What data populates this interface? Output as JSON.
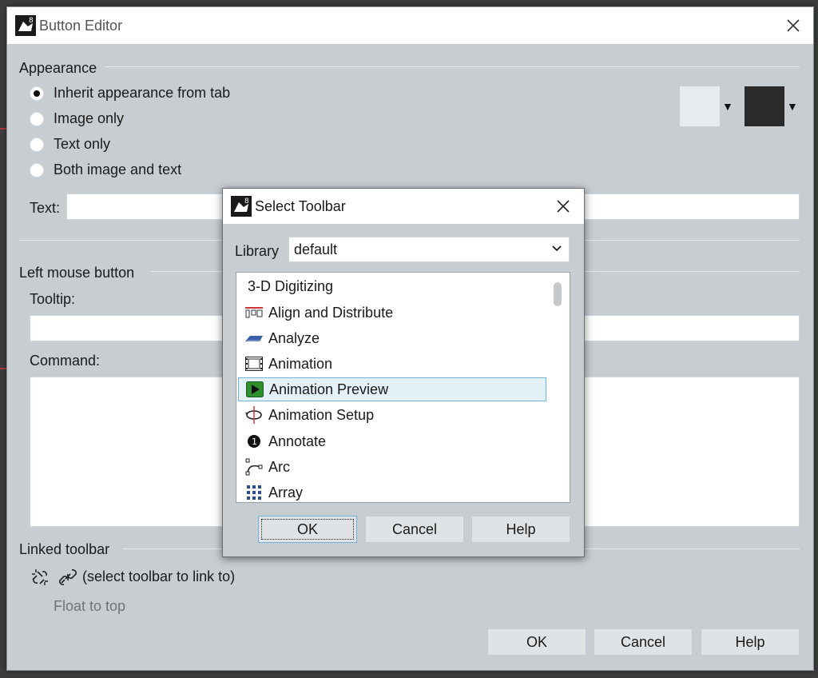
{
  "dialog": {
    "title": "Button Editor",
    "appearance_label": "Appearance",
    "radios": [
      {
        "label": "Inherit appearance from tab",
        "checked": true
      },
      {
        "label": "Image only",
        "checked": false
      },
      {
        "label": "Text only",
        "checked": false
      },
      {
        "label": "Both image and text",
        "checked": false
      }
    ],
    "swatch_light": "#e9ecef",
    "swatch_dark": "#2a2a2a",
    "text_label": "Text:",
    "text_value": "",
    "left_mouse_label": "Left mouse button",
    "tooltip_label": "Tooltip:",
    "tooltip_value": "",
    "command_label": "Command:",
    "command_value": "",
    "linked_toolbar_label": "Linked toolbar",
    "link_hint": "(select toolbar to link to)",
    "float_to_top": "Float to top",
    "ok": "OK",
    "cancel": "Cancel",
    "help": "Help"
  },
  "select_toolbar": {
    "title": "Select Toolbar",
    "library_label": "Library",
    "library_value": "default",
    "items": [
      {
        "label": "3-D Digitizing",
        "icon": "none"
      },
      {
        "label": "Align and Distribute",
        "icon": "align-icon"
      },
      {
        "label": "Analyze",
        "icon": "analyze-icon"
      },
      {
        "label": "Animation",
        "icon": "film-icon"
      },
      {
        "label": "Animation Preview",
        "icon": "play-icon",
        "selected": true
      },
      {
        "label": "Animation Setup",
        "icon": "rotate-icon"
      },
      {
        "label": "Annotate",
        "icon": "annotate-icon"
      },
      {
        "label": "Arc",
        "icon": "arc-icon"
      },
      {
        "label": "Array",
        "icon": "grid-icon"
      }
    ],
    "ok": "OK",
    "cancel": "Cancel",
    "help": "Help"
  },
  "colors": {
    "dialog_bg": "#c8cdd1",
    "selection_bg": "#e4f1f8",
    "selection_border": "#6fb3da"
  }
}
